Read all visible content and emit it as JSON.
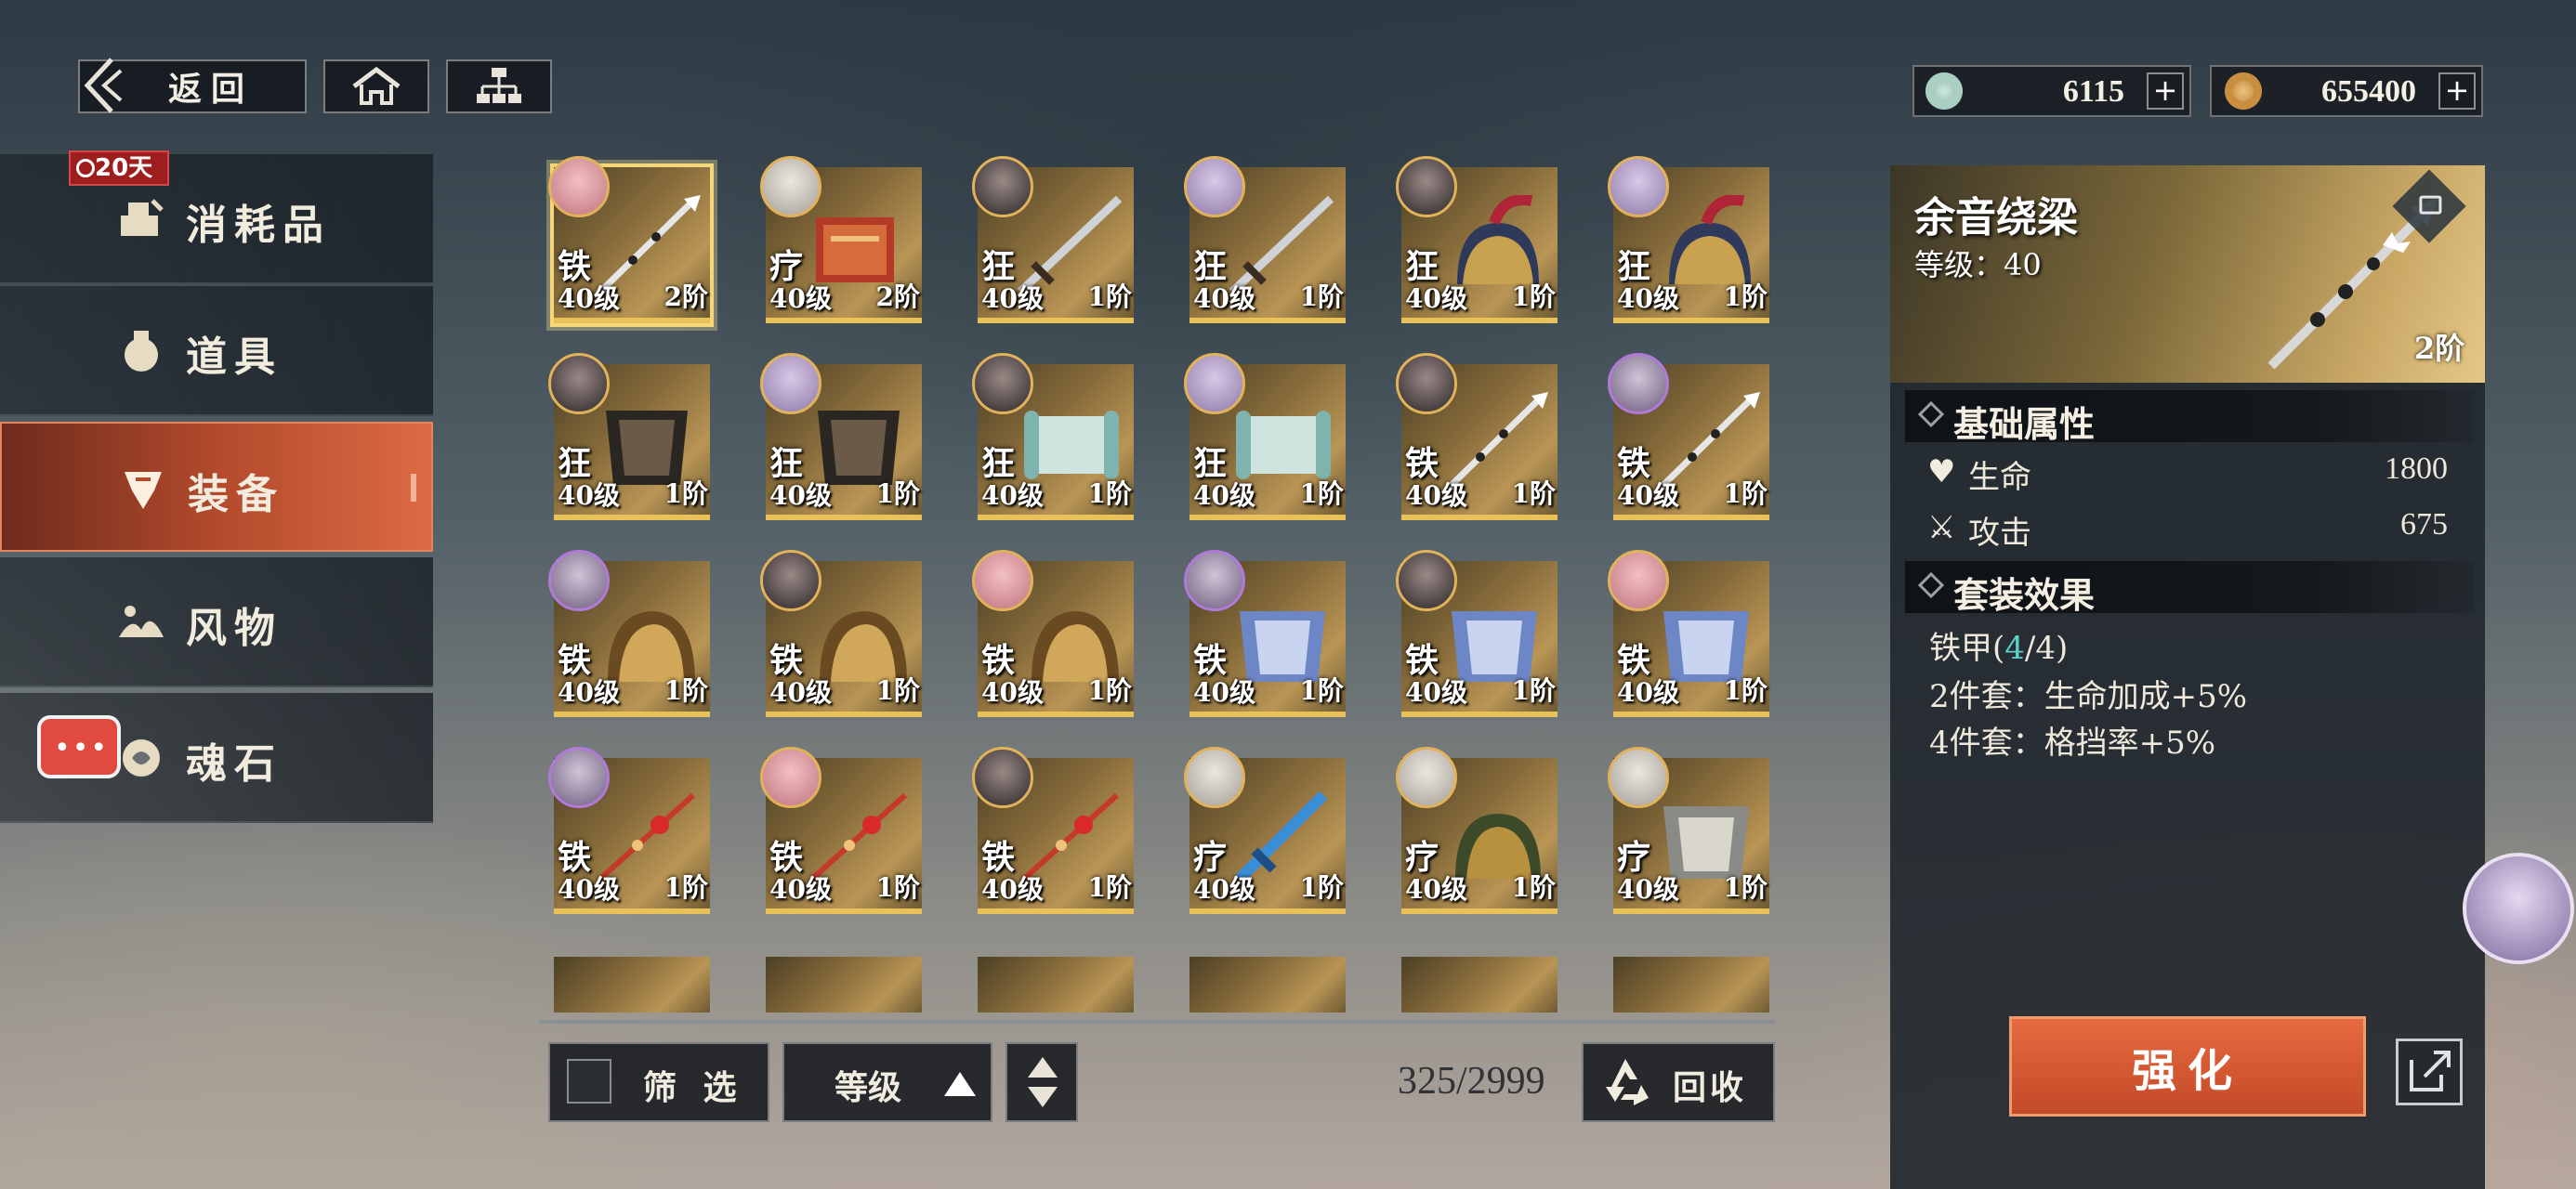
{
  "topbar": {
    "back_label": "返回",
    "home_icon": "home-icon",
    "tree_icon": "hierarchy-icon",
    "currency1": {
      "icon": "jade-coin-icon",
      "value": "6115"
    },
    "currency2": {
      "icon": "copper-coin-icon",
      "value": "655400"
    }
  },
  "sidebar": {
    "timer_badge": "20天",
    "items": [
      {
        "label": "消耗品",
        "icon": "consumables-icon"
      },
      {
        "label": "道具",
        "icon": "items-icon"
      },
      {
        "label": "装备",
        "icon": "equipment-icon",
        "active": true
      },
      {
        "label": "风物",
        "icon": "scenery-icon"
      },
      {
        "label": "魂石",
        "icon": "soulstone-icon"
      }
    ]
  },
  "grid": {
    "rows": [
      [
        {
          "cls": "铁",
          "level": "40级",
          "tier": "2阶",
          "avatar": "pink",
          "gear": "spear",
          "selected": true
        },
        {
          "cls": "疗",
          "level": "40级",
          "tier": "2阶",
          "avatar": "white",
          "gear": "book"
        },
        {
          "cls": "狂",
          "level": "40级",
          "tier": "1阶",
          "avatar": "dark",
          "gear": "sword"
        },
        {
          "cls": "狂",
          "level": "40级",
          "tier": "1阶",
          "avatar": "lav",
          "gear": "sword"
        },
        {
          "cls": "狂",
          "level": "40级",
          "tier": "1阶",
          "avatar": "dark",
          "gear": "helmet"
        },
        {
          "cls": "狂",
          "level": "40级",
          "tier": "1阶",
          "avatar": "lav",
          "gear": "helmet"
        }
      ],
      [
        {
          "cls": "狂",
          "level": "40级",
          "tier": "1阶",
          "avatar": "dark",
          "gear": "armor"
        },
        {
          "cls": "狂",
          "level": "40级",
          "tier": "1阶",
          "avatar": "lav",
          "gear": "armor"
        },
        {
          "cls": "狂",
          "level": "40级",
          "tier": "1阶",
          "avatar": "dark",
          "gear": "scroll"
        },
        {
          "cls": "狂",
          "level": "40级",
          "tier": "1阶",
          "avatar": "lav",
          "gear": "scroll"
        },
        {
          "cls": "铁",
          "level": "40级",
          "tier": "1阶",
          "avatar": "dark",
          "gear": "spear"
        },
        {
          "cls": "铁",
          "level": "40级",
          "tier": "1阶",
          "avatar": "purple",
          "gear": "spear"
        }
      ],
      [
        {
          "cls": "铁",
          "level": "40级",
          "tier": "1阶",
          "avatar": "purple",
          "gear": "goldhelm"
        },
        {
          "cls": "铁",
          "level": "40级",
          "tier": "1阶",
          "avatar": "dark",
          "gear": "goldhelm"
        },
        {
          "cls": "铁",
          "level": "40级",
          "tier": "1阶",
          "avatar": "pink",
          "gear": "goldhelm"
        },
        {
          "cls": "铁",
          "level": "40级",
          "tier": "1阶",
          "avatar": "purple",
          "gear": "bluearmor"
        },
        {
          "cls": "铁",
          "level": "40级",
          "tier": "1阶",
          "avatar": "dark",
          "gear": "bluearmor"
        },
        {
          "cls": "铁",
          "level": "40级",
          "tier": "1阶",
          "avatar": "pink",
          "gear": "bluearmor"
        }
      ],
      [
        {
          "cls": "铁",
          "level": "40级",
          "tier": "1阶",
          "avatar": "purple",
          "gear": "hairpin"
        },
        {
          "cls": "铁",
          "level": "40级",
          "tier": "1阶",
          "avatar": "pink",
          "gear": "hairpin"
        },
        {
          "cls": "铁",
          "level": "40级",
          "tier": "1阶",
          "avatar": "dark",
          "gear": "hairpin"
        },
        {
          "cls": "疗",
          "level": "40级",
          "tier": "1阶",
          "avatar": "white",
          "gear": "bluesword"
        },
        {
          "cls": "疗",
          "level": "40级",
          "tier": "1阶",
          "avatar": "white",
          "gear": "greenhelm"
        },
        {
          "cls": "疗",
          "level": "40级",
          "tier": "1阶",
          "avatar": "white",
          "gear": "silverarmor"
        }
      ]
    ]
  },
  "controls": {
    "filter_label": "筛 选",
    "sort_label": "等级",
    "count": "325/2999",
    "recycle_label": "回收"
  },
  "detail": {
    "name": "余音绕梁",
    "level_text": "等级：40",
    "tier": "2阶",
    "base_title": "基础属性",
    "stats": [
      {
        "label": "生命",
        "value": "1800",
        "icon": "heart-icon"
      },
      {
        "label": "攻击",
        "value": "675",
        "icon": "crossed-swords-icon"
      }
    ],
    "set_title": "套装效果",
    "set_name_prefix": "铁甲(",
    "set_count": "4",
    "set_name_suffix": "/4)",
    "set_bonus_2": "2件套：生命加成+5%",
    "set_bonus_4": "4件套：格挡率+5%",
    "enhance_label": "强化"
  },
  "colors": {
    "accent": "#dd6a44",
    "gold": "#e8c258",
    "teal": "#5fd0c8"
  }
}
